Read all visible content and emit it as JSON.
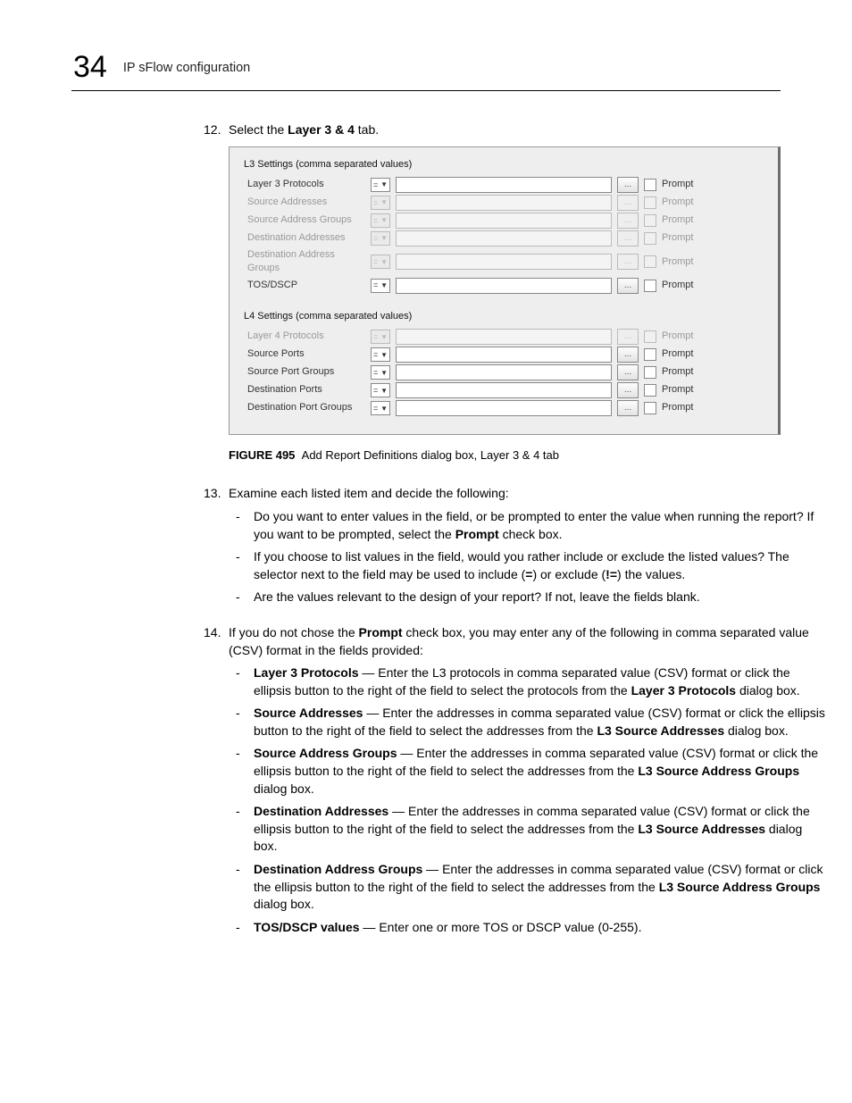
{
  "header": {
    "chapter_number": "34",
    "title": "IP sFlow configuration"
  },
  "step12": {
    "num": "12.",
    "pre": "Select the ",
    "bold": "Layer 3 & 4",
    "post": " tab."
  },
  "figure": {
    "l3_title": "L3 Settings (comma separated values)",
    "l4_title": "L4 Settings (comma separated values)",
    "l3_rows": [
      {
        "label": "Layer 3 Protocols",
        "disabled": false
      },
      {
        "label": "Source Addresses",
        "disabled": true
      },
      {
        "label": "Source Address Groups",
        "disabled": true
      },
      {
        "label": "Destination Addresses",
        "disabled": true
      },
      {
        "label": "Destination Address Groups",
        "disabled": true
      },
      {
        "label": "TOS/DSCP",
        "disabled": false
      }
    ],
    "l4_rows": [
      {
        "label": "Layer 4 Protocols",
        "disabled": true
      },
      {
        "label": "Source Ports",
        "disabled": false
      },
      {
        "label": "Source Port Groups",
        "disabled": false
      },
      {
        "label": "Destination Ports",
        "disabled": false
      },
      {
        "label": "Destination Port Groups",
        "disabled": false
      }
    ],
    "ellipsis": "...",
    "sel_glyph": "▼",
    "prompt_label": "Prompt",
    "caption_bold": "FIGURE 495",
    "caption_rest": "Add Report Definitions dialog box, Layer 3 & 4 tab"
  },
  "step13": {
    "num": "13.",
    "text": "Examine each listed item and decide the following:",
    "bullets": [
      {
        "pre": "Do you want to enter values in the field, or be prompted to enter the value when running the report? If you want to be prompted, select the ",
        "bold": "Prompt",
        "post": " check box."
      },
      {
        "pre": "If you choose to list values in the field, would you rather include or exclude the listed values? The selector next to the field may be used to include (",
        "bold": "=",
        "mid": ") or exclude (",
        "bold2": "!=",
        "post": ") the values."
      },
      {
        "pre": "Are the values relevant to the design of your report? If not, leave the fields blank."
      }
    ]
  },
  "step14": {
    "num": "14.",
    "pre": "If you do not chose the ",
    "bold": "Prompt",
    "post": " check box, you may enter any of the following in comma separated value (CSV) format in the fields provided:",
    "bullets": [
      {
        "b1": "Layer 3 Protocols",
        "t1": " — Enter the L3 protocols in comma separated value (CSV) format or click the ellipsis button to the right of the field to select the protocols from the ",
        "b2": "Layer 3 Protocols",
        "t2": " dialog box."
      },
      {
        "b1": "Source Addresses",
        "t1": " — Enter the addresses in comma separated value (CSV) format or click the ellipsis button to the right of the field to select the addresses from the ",
        "b2": "L3 Source Addresses",
        "t2": " dialog box."
      },
      {
        "b1": "Source Address Groups",
        "t1": " — Enter the addresses in comma separated value (CSV) format or click the ellipsis button to the right of the field to select the addresses from the ",
        "b2": "L3 Source Address Groups",
        "t2": " dialog box."
      },
      {
        "b1": "Destination Addresses ",
        "t1": " — Enter the addresses in comma separated value (CSV) format or click the ellipsis button to the right of the field to select the addresses from the ",
        "b2": "L3 Source Addresses",
        "t2": " dialog box."
      },
      {
        "b1": "Destination Address Groups",
        "t1": " — Enter the addresses in comma separated value (CSV) format or click the ellipsis button to the right of the field to select the addresses from the ",
        "b2": "L3 Source Address Groups",
        "t2": " dialog box."
      },
      {
        "b1": "TOS/DSCP values",
        "t1": " — Enter one or more TOS or DSCP value (0-255)."
      }
    ]
  }
}
